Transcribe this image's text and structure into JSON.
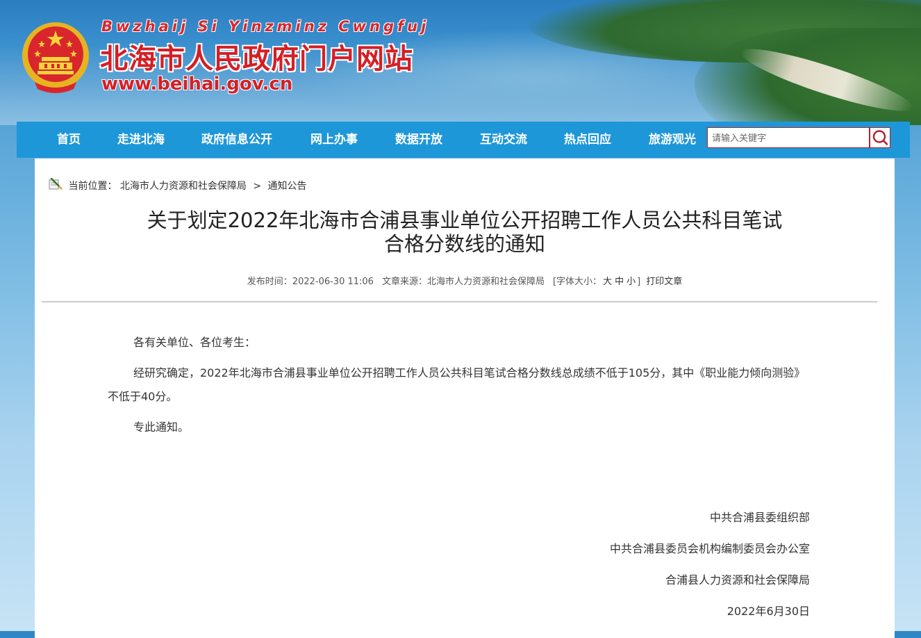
{
  "header": {
    "site_roman": "Bwzhaij Si Yinzminz Cwngfuj",
    "site_title": "北海市人民政府门户网站",
    "site_url": "www.beihai.gov.cn"
  },
  "nav": {
    "items": [
      {
        "label": "首页"
      },
      {
        "label": "走进北海"
      },
      {
        "label": "政府信息公开"
      },
      {
        "label": "网上办事"
      },
      {
        "label": "数据开放"
      },
      {
        "label": "互动交流"
      },
      {
        "label": "热点回应"
      },
      {
        "label": "旅游观光"
      }
    ],
    "search_placeholder": "请输入关键字"
  },
  "breadcrumb": {
    "prefix": "当前位置：",
    "items": [
      "北海市人力资源和社会保障局",
      "通知公告"
    ],
    "separator": ">"
  },
  "article": {
    "title_line1": "关于划定2022年北海市合浦县事业单位公开招聘工作人员公共科目笔试",
    "title_line2": "合格分数线的通知",
    "meta": {
      "publish_label": "发布时间：",
      "publish_time": "2022-06-30 11:06",
      "source_label": "文章来源：",
      "source": "北海市人力资源和社会保障局",
      "fontsize_label": "[字体大小：",
      "fontsize_large": "大",
      "fontsize_medium": "中",
      "fontsize_small": "小",
      "fontsize_close": "]",
      "print": "打印文章"
    },
    "paragraphs": [
      "各有关单位、各位考生：",
      "经研究确定，2022年北海市合浦县事业单位公开招聘工作人员公共科目笔试合格分数线总成绩不低于105分，其中《职业能力倾向测验》不低于40分。",
      "专此通知。"
    ],
    "signatures": [
      "中共合浦县委组织部",
      "中共合浦县委员会机构编制委员会办公室",
      "合浦县人力资源和社会保障局",
      "2022年6月30日"
    ]
  },
  "colors": {
    "nav_bg": "#1e97d9",
    "title_red": "#d41f25",
    "search_border": "#b51f2a"
  }
}
